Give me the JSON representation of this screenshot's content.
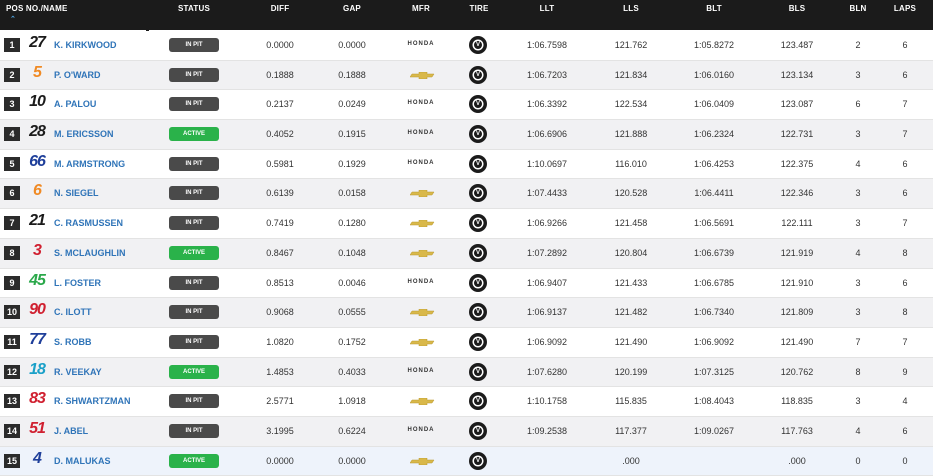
{
  "header": {
    "pos_name": "POS NO./NAME",
    "status": "STATUS",
    "diff": "DIFF",
    "gap": "GAP",
    "mfr": "MFR",
    "tire": "TIRE",
    "llt": "LLT",
    "lls": "LLS",
    "blt": "BLT",
    "bls": "BLS",
    "bln": "BLN",
    "laps": "LAPS"
  },
  "sort_icon": "sort-caret-icon",
  "status_colors": {
    "IN PIT": "#4a4a4a",
    "ACTIVE": "#2ab24a"
  },
  "rows": [
    {
      "pos": "1",
      "car": "27",
      "car_color": "#1b1b1b",
      "name": "K. KIRKWOOD",
      "status": "IN PIT",
      "diff": "0.0000",
      "gap": "0.0000",
      "mfr": "HONDA",
      "llt": "1:06.7598",
      "lls": "121.762",
      "blt": "1:05.8272",
      "bls": "123.487",
      "bln": "2",
      "laps": "6"
    },
    {
      "pos": "2",
      "car": "5",
      "car_color": "#f08a24",
      "name": "P. O'WARD",
      "status": "IN PIT",
      "diff": "0.1888",
      "gap": "0.1888",
      "mfr": "CHEVROLET",
      "llt": "1:06.7203",
      "lls": "121.834",
      "blt": "1:06.0160",
      "bls": "123.134",
      "bln": "3",
      "laps": "6"
    },
    {
      "pos": "3",
      "car": "10",
      "car_color": "#1b1b1b",
      "name": "A. PALOU",
      "status": "IN PIT",
      "diff": "0.2137",
      "gap": "0.0249",
      "mfr": "HONDA",
      "llt": "1:06.3392",
      "lls": "122.534",
      "blt": "1:06.0409",
      "bls": "123.087",
      "bln": "6",
      "laps": "7"
    },
    {
      "pos": "4",
      "car": "28",
      "car_color": "#1b1b1b",
      "name": "M. ERICSSON",
      "status": "ACTIVE",
      "diff": "0.4052",
      "gap": "0.1915",
      "mfr": "HONDA",
      "llt": "1:06.6906",
      "lls": "121.888",
      "blt": "1:06.2324",
      "bls": "122.731",
      "bln": "3",
      "laps": "7"
    },
    {
      "pos": "5",
      "car": "66",
      "car_color": "#1f3f9a",
      "name": "M. ARMSTRONG",
      "status": "IN PIT",
      "diff": "0.5981",
      "gap": "0.1929",
      "mfr": "HONDA",
      "llt": "1:10.0697",
      "lls": "116.010",
      "blt": "1:06.4253",
      "bls": "122.375",
      "bln": "4",
      "laps": "6"
    },
    {
      "pos": "6",
      "car": "6",
      "car_color": "#f08a24",
      "name": "N. SIEGEL",
      "status": "IN PIT",
      "diff": "0.6139",
      "gap": "0.0158",
      "mfr": "CHEVROLET",
      "llt": "1:07.4433",
      "lls": "120.528",
      "blt": "1:06.4411",
      "bls": "122.346",
      "bln": "3",
      "laps": "6"
    },
    {
      "pos": "7",
      "car": "21",
      "car_color": "#1b1b1b",
      "name": "C. RASMUSSEN",
      "status": "IN PIT",
      "diff": "0.7419",
      "gap": "0.1280",
      "mfr": "CHEVROLET",
      "llt": "1:06.9266",
      "lls": "121.458",
      "blt": "1:06.5691",
      "bls": "122.111",
      "bln": "3",
      "laps": "7"
    },
    {
      "pos": "8",
      "car": "3",
      "car_color": "#d02030",
      "name": "S. MCLAUGHLIN",
      "status": "ACTIVE",
      "diff": "0.8467",
      "gap": "0.1048",
      "mfr": "CHEVROLET",
      "llt": "1:07.2892",
      "lls": "120.804",
      "blt": "1:06.6739",
      "bls": "121.919",
      "bln": "4",
      "laps": "8"
    },
    {
      "pos": "9",
      "car": "45",
      "car_color": "#2aa84a",
      "name": "L. FOSTER",
      "status": "IN PIT",
      "diff": "0.8513",
      "gap": "0.0046",
      "mfr": "HONDA",
      "llt": "1:06.9407",
      "lls": "121.433",
      "blt": "1:06.6785",
      "bls": "121.910",
      "bln": "3",
      "laps": "6"
    },
    {
      "pos": "10",
      "car": "90",
      "car_color": "#d02030",
      "name": "C. ILOTT",
      "status": "IN PIT",
      "diff": "0.9068",
      "gap": "0.0555",
      "mfr": "CHEVROLET",
      "llt": "1:06.9137",
      "lls": "121.482",
      "blt": "1:06.7340",
      "bls": "121.809",
      "bln": "3",
      "laps": "8"
    },
    {
      "pos": "11",
      "car": "77",
      "car_color": "#1f3f9a",
      "name": "S. ROBB",
      "status": "IN PIT",
      "diff": "1.0820",
      "gap": "0.1752",
      "mfr": "CHEVROLET",
      "llt": "1:06.9092",
      "lls": "121.490",
      "blt": "1:06.9092",
      "bls": "121.490",
      "bln": "7",
      "laps": "7"
    },
    {
      "pos": "12",
      "car": "18",
      "car_color": "#1aa0c8",
      "name": "R. VEEKAY",
      "status": "ACTIVE",
      "diff": "1.4853",
      "gap": "0.4033",
      "mfr": "HONDA",
      "llt": "1:07.6280",
      "lls": "120.199",
      "blt": "1:07.3125",
      "bls": "120.762",
      "bln": "8",
      "laps": "9"
    },
    {
      "pos": "13",
      "car": "83",
      "car_color": "#d02030",
      "name": "R. SHWARTZMAN",
      "status": "IN PIT",
      "diff": "2.5771",
      "gap": "1.0918",
      "mfr": "CHEVROLET",
      "llt": "1:10.1758",
      "lls": "115.835",
      "blt": "1:08.4043",
      "bls": "118.835",
      "bln": "3",
      "laps": "4"
    },
    {
      "pos": "14",
      "car": "51",
      "car_color": "#d02030",
      "name": "J. ABEL",
      "status": "IN PIT",
      "diff": "3.1995",
      "gap": "0.6224",
      "mfr": "HONDA",
      "llt": "1:09.2538",
      "lls": "117.377",
      "blt": "1:09.0267",
      "bls": "117.763",
      "bln": "4",
      "laps": "6"
    },
    {
      "pos": "15",
      "car": "4",
      "car_color": "#1f3f9a",
      "name": "D. MALUKAS",
      "status": "ACTIVE",
      "diff": "0.0000",
      "gap": "0.0000",
      "mfr": "CHEVROLET",
      "llt": "",
      "lls": ".000",
      "blt": "",
      "bls": ".000",
      "bln": "0",
      "laps": "0"
    }
  ]
}
